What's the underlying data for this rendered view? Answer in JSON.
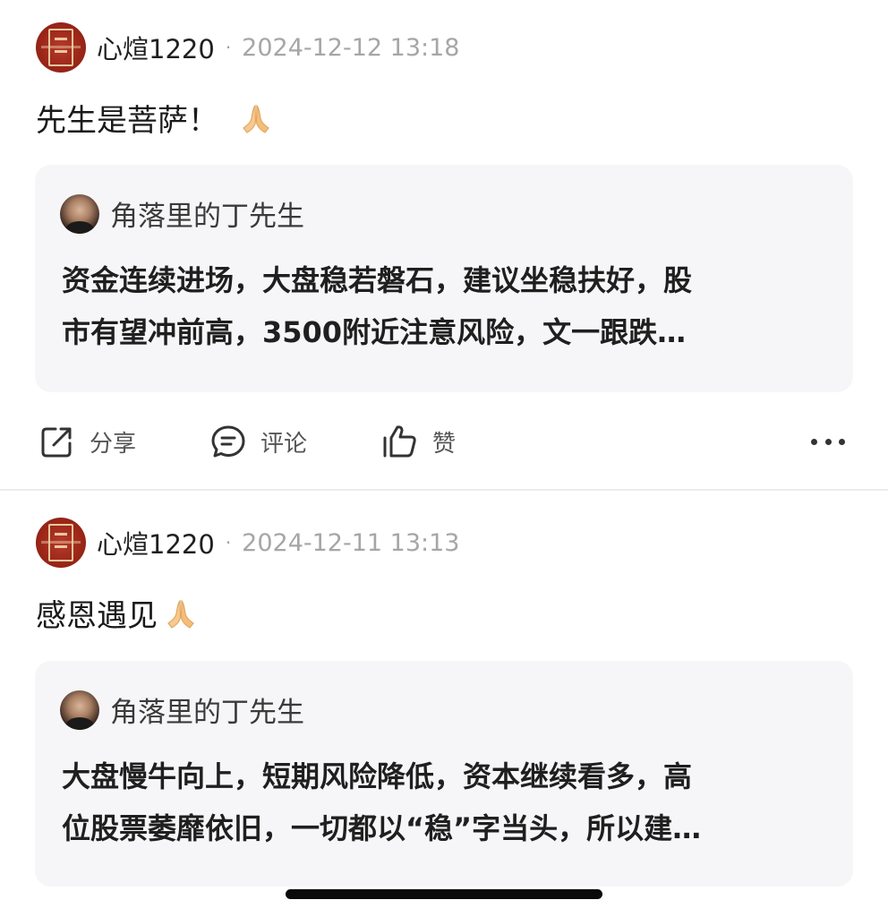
{
  "posts": [
    {
      "author": "心煊1220",
      "separator": "·",
      "time": "2024-12-12 13:18",
      "comment": "先生是菩萨！",
      "emoji_icon": "folded-hands-icon",
      "quote": {
        "name": "角落里的丁先生",
        "lines": [
          "资金连续进场，大盘稳若磐石，建议坐稳扶好，股",
          "市有望冲前高，3500附近注意风险，文一跟跌…"
        ]
      },
      "actions": {
        "share": "分享",
        "comment": "评论",
        "like": "赞"
      }
    },
    {
      "author": "心煊1220",
      "separator": "·",
      "time": "2024-12-11 13:13",
      "comment": "感恩遇见",
      "emoji_icon": "folded-hands-icon",
      "quote": {
        "name": "角落里的丁先生",
        "lines": [
          "大盘慢牛向上，短期风险降低，资本继续看多，高",
          "位股票萎靡依旧，一切都以“稳”字当头，所以建…"
        ]
      }
    }
  ],
  "colors": {
    "quote_bg": "#f6f6f8",
    "timestamp": "#a6a6a6",
    "avatar_red": "#9a2618"
  }
}
